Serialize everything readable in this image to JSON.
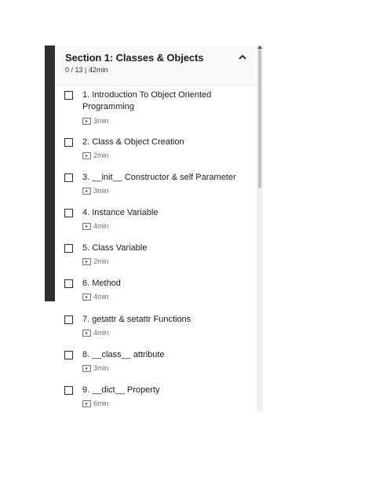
{
  "section": {
    "title": "Section 1: Classes & Objects",
    "meta": "0 / 13 | 42min"
  },
  "lectures": [
    {
      "title": "1. Introduction To Object Oriented Programming",
      "duration": "3min"
    },
    {
      "title": "2. Class & Object Creation",
      "duration": "2min"
    },
    {
      "title": "3. __init__ Constructor & self Parameter",
      "duration": "3min"
    },
    {
      "title": "4. Instance Variable",
      "duration": "4min"
    },
    {
      "title": "5. Class Variable",
      "duration": "2min"
    },
    {
      "title": "6. Method",
      "duration": "4min"
    },
    {
      "title": "7. getattr & setattr Functions",
      "duration": "4min"
    },
    {
      "title": "8. __class__ attribute",
      "duration": "3min"
    },
    {
      "title": "9. __dict__ Property",
      "duration": "6min"
    }
  ],
  "icons": {
    "collapse": "chevron-up-icon",
    "lecture_type": "video-play-icon"
  }
}
